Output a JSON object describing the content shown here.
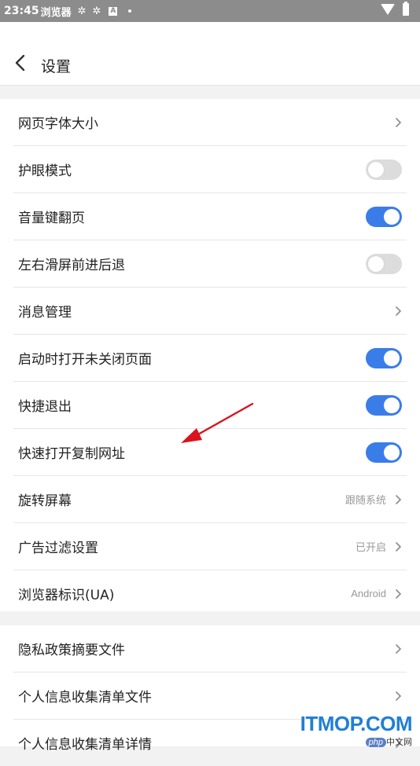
{
  "status_bar": {
    "time": "23:45",
    "app_name": "浏览器",
    "badge": "A"
  },
  "header": {
    "title": "设置"
  },
  "group1": [
    {
      "label": "网页字体大小",
      "kind": "chevron",
      "value": ""
    },
    {
      "label": "护眼模式",
      "kind": "toggle",
      "on": false
    },
    {
      "label": "音量键翻页",
      "kind": "toggle",
      "on": true
    },
    {
      "label": "左右滑屏前进后退",
      "kind": "toggle",
      "on": false
    },
    {
      "label": "消息管理",
      "kind": "chevron",
      "value": ""
    },
    {
      "label": "启动时打开未关闭页面",
      "kind": "toggle",
      "on": true
    },
    {
      "label": "快捷退出",
      "kind": "toggle",
      "on": true
    },
    {
      "label": "快速打开复制网址",
      "kind": "toggle",
      "on": true
    },
    {
      "label": "旋转屏幕",
      "kind": "chevron",
      "value": "跟随系统"
    },
    {
      "label": "广告过滤设置",
      "kind": "chevron",
      "value": "已开启"
    },
    {
      "label": "浏览器标识(UA)",
      "kind": "chevron",
      "value": "Android"
    }
  ],
  "group2": [
    {
      "label": "隐私政策摘要文件",
      "kind": "chevron",
      "value": ""
    },
    {
      "label": "个人信息收集清单文件",
      "kind": "chevron",
      "value": ""
    },
    {
      "label": "个人信息收集清单详情",
      "kind": "chevron",
      "value": ""
    }
  ],
  "watermark": {
    "top": "ITMOP.COM",
    "php": "php",
    "cn": "中文网"
  },
  "colors": {
    "toggle_on": "#3b7de8",
    "toggle_off": "#dcdcdc",
    "arrow": "#d9141e"
  }
}
